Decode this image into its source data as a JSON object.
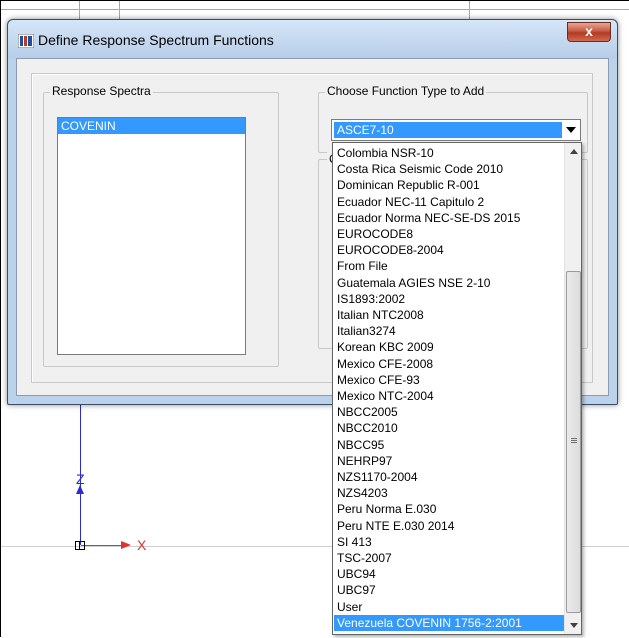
{
  "window": {
    "title": "Define Response Spectrum Functions",
    "close_glyph": "x"
  },
  "response_spectra": {
    "label": "Response Spectra",
    "items": [
      "COVENIN"
    ],
    "selected": "COVENIN"
  },
  "function_type": {
    "label": "Choose  Function Type to Add",
    "selected": "ASCE7-10",
    "hidden_group_fragment": "C"
  },
  "dropdown": {
    "items": [
      "Colombia NSR-10",
      "Costa Rica Seismic Code 2010",
      "Dominican Republic R-001",
      "Ecuador NEC-11 Capitulo 2",
      "Ecuador Norma NEC-SE-DS 2015",
      "EUROCODE8",
      "EUROCODE8-2004",
      "From File",
      "Guatemala AGIES NSE 2-10",
      "IS1893:2002",
      "Italian NTC2008",
      "Italian3274",
      "Korean KBC 2009",
      "Mexico CFE-2008",
      "Mexico CFE-93",
      "Mexico NTC-2004",
      "NBCC2005",
      "NBCC2010",
      "NBCC95",
      "NEHRP97",
      "NZS1170-2004",
      "NZS4203",
      "Peru Norma E.030",
      "Peru NTE E.030 2014",
      "SI 413",
      "TSC-2007",
      "UBC94",
      "UBC97",
      "User",
      "Venezuela COVENIN 1756-2:2001"
    ],
    "selected_index": 29
  },
  "canvas": {
    "axis_z_label": "Z",
    "axis_x_label": "X",
    "axis_x_color": "#e03030",
    "axis_z_color": "#2a2ad8"
  },
  "colors": {
    "selection": "#3399ff",
    "title_bar": "#bcd2ea",
    "close_button": "#c75a42"
  }
}
